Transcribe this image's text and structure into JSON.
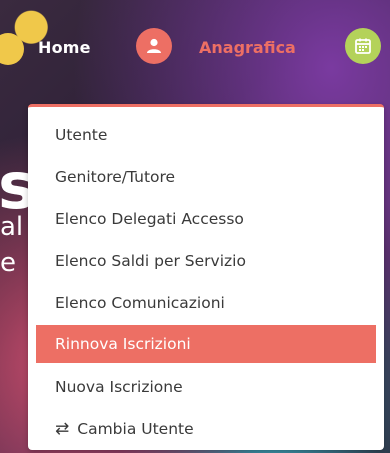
{
  "nav": {
    "home_label": "Home",
    "anagrafica_label": "Anagrafica",
    "icons": [
      "user-icon",
      "calendar-icon"
    ],
    "colors": {
      "accent": "#ed6f64",
      "green": "#b4d25a",
      "yellow": "#f0c84a"
    }
  },
  "menu": {
    "items": [
      {
        "label": "Utente",
        "active": false
      },
      {
        "label": "Genitore/Tutore",
        "active": false
      },
      {
        "label": "Elenco Delegati Accesso",
        "active": false
      },
      {
        "label": "Elenco Saldi per Servizio",
        "active": false
      },
      {
        "label": "Elenco Comunicazioni",
        "active": false
      },
      {
        "label": "Rinnova Iscrizioni",
        "active": true
      },
      {
        "label": "Nuova Iscrizione",
        "active": false
      },
      {
        "label": "Cambia Utente",
        "active": false,
        "icon": "swap-icon"
      }
    ]
  }
}
